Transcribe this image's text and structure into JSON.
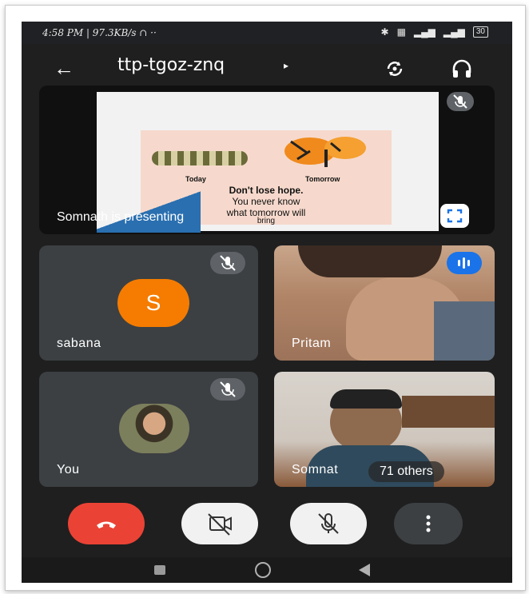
{
  "status": {
    "time_speed": "4:58 PM | 97.3KB/s ∩ ··",
    "icons": [
      "bluetooth-icon",
      "vibrate-icon",
      "signal-icon",
      "signal-icon"
    ],
    "battery": "30"
  },
  "appbar": {
    "title": "ttp-tgoz-znq",
    "back_icon": "back-arrow-icon",
    "caret": "▸",
    "rotate_icon": "camera-switch-icon",
    "audio_icon": "headphones-icon"
  },
  "presentation": {
    "label": "Somnath is presenting",
    "slide": {
      "left_caption": "Today",
      "right_caption": "Tomorrow",
      "line1": "Don't lose hope.",
      "line2": "You never know",
      "line3": "what tomorrow will",
      "line4": "bring"
    }
  },
  "participants": [
    {
      "name": "sabana",
      "avatar_letter": "S",
      "avatar_color": "#f57c00",
      "muted": true
    },
    {
      "name": "Pritam",
      "muted": false,
      "speaking": true
    },
    {
      "name": "You",
      "muted": true
    },
    {
      "name": "Somnat",
      "others": "71 others"
    }
  ],
  "colors": {
    "end_call": "#ea4335",
    "tile": "#3c4043",
    "speaking": "#1a73e8"
  }
}
